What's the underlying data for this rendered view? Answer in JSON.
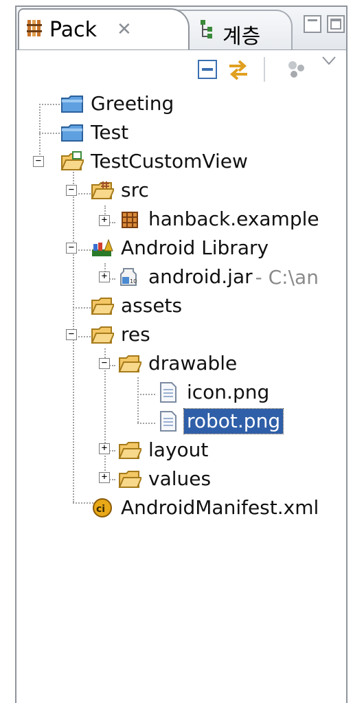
{
  "tabs": {
    "package": {
      "label": "Pack",
      "close": "✕"
    },
    "hierarchy": {
      "label": "계층"
    }
  },
  "window": {
    "minimize": "minimize",
    "maximize": "maximize"
  },
  "toolbar": {
    "collapse_all": "collapse-all",
    "link_editor": "link-with-editor",
    "filters": "filters",
    "menu": "view-menu"
  },
  "tree": {
    "greeting": "Greeting",
    "test": "Test",
    "project": "TestCustomView",
    "src": "src",
    "package": "hanback.example",
    "android_library": "Android Library",
    "android_jar": "android.jar",
    "android_jar_path": "- C:\\an",
    "assets": "assets",
    "res": "res",
    "drawable": "drawable",
    "icon_png": "icon.png",
    "robot_png": "robot.png",
    "layout": "layout",
    "values": "values",
    "manifest": "AndroidManifest.xml"
  },
  "colors": {
    "selection": "#2f5fa8",
    "folder": "#f3c766",
    "project_folder": "#5fa0e0"
  }
}
